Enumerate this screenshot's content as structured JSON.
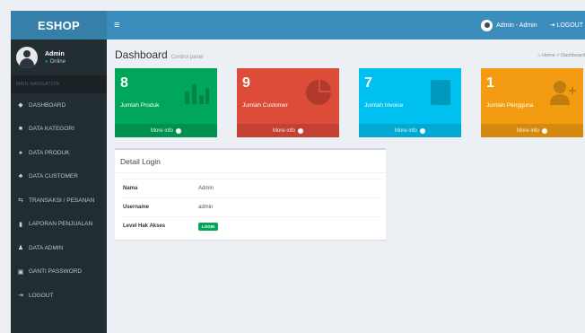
{
  "header": {
    "logo": "ESHOP",
    "toggle_icon": "≡",
    "user_label": "Admin - Admin",
    "logout_label": "LOGOUT"
  },
  "sidebar": {
    "user_name": "Admin",
    "user_status": "Online",
    "menu_header": "MAIN NAVIGATION",
    "items": [
      {
        "icon": "dashboard-icon",
        "glyph": "◆",
        "label": "DASHBOARD"
      },
      {
        "icon": "bookmark-icon",
        "glyph": "■",
        "label": "DATA KATEGORI"
      },
      {
        "icon": "cubes-icon",
        "glyph": "♠",
        "label": "DATA PRODUK"
      },
      {
        "icon": "users-icon",
        "glyph": "♣",
        "label": "DATA CUSTOMER"
      },
      {
        "icon": "exchange-icon",
        "glyph": "⇆",
        "label": "TRANSAKSI / PESANAN"
      },
      {
        "icon": "file-icon",
        "glyph": "▮",
        "label": "LAPORAN PENJUALAN"
      },
      {
        "icon": "user-icon",
        "glyph": "♟",
        "label": "DATA ADMIN"
      },
      {
        "icon": "lock-icon",
        "glyph": "▣",
        "label": "GANTI PASSWORD"
      },
      {
        "icon": "sign-out-icon",
        "glyph": "⇥",
        "label": "LOGOUT"
      }
    ]
  },
  "main": {
    "title": "Dashboard",
    "subtitle": "Control panel",
    "breadcrumb": "Home > Dashboard",
    "boxes": [
      {
        "number": "8",
        "label": "Jumlah Produk",
        "footer": "More info",
        "color": "#00a65a"
      },
      {
        "number": "9",
        "label": "Jumlah Customer",
        "footer": "More info",
        "color": "#dd4b39"
      },
      {
        "number": "7",
        "label": "Jumlah Invoice",
        "footer": "More info",
        "color": "#00c0ef"
      },
      {
        "number": "1",
        "label": "Jumlah Pengguna",
        "footer": "More info",
        "color": "#f39c12"
      }
    ],
    "detail": {
      "title": "Detail Login",
      "rows": [
        {
          "key": "Nama",
          "value": "Admin"
        },
        {
          "key": "Username",
          "value": "admin"
        },
        {
          "key": "Level Hak Akses",
          "value": "LOGIN"
        }
      ]
    }
  }
}
